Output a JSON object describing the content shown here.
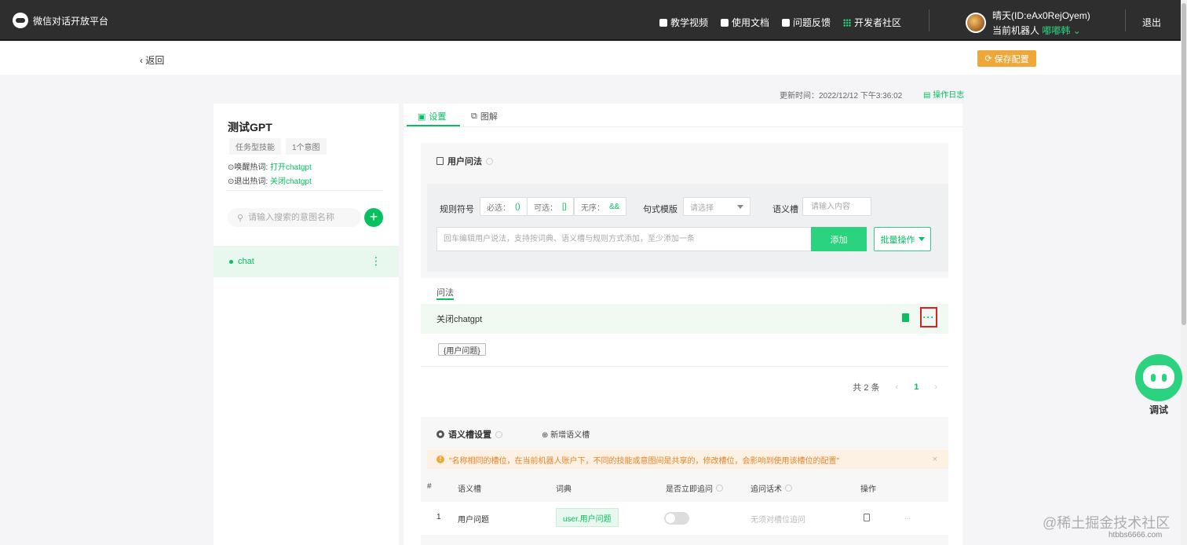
{
  "topbar": {
    "brand": "微信对话开放平台",
    "nav": [
      "教学视频",
      "使用文档",
      "问题反馈",
      "开发者社区"
    ],
    "user_name": "晴天(ID:eAx0RejOyem)",
    "robot_label": "当前机器人",
    "robot_name": "嘟嘟韩",
    "logout": "退出"
  },
  "subheader": {
    "back": "返回",
    "save": "保存配置"
  },
  "meta": {
    "updated": "更新时间：2022/12/12 下午3:36:02",
    "oplog": "操作日志"
  },
  "skill": {
    "title": "测试GPT",
    "tags": [
      "任务型技能",
      "1个意图"
    ],
    "wake_label": "唤醒热词:",
    "wake_value": "打开chatgpt",
    "exit_label": "退出热词:",
    "exit_value": "关闭chatgpt",
    "search_placeholder": "请输入搜索的意图名称",
    "add": "+",
    "intents": [
      "chat"
    ]
  },
  "tabs": [
    "设置",
    "图解"
  ],
  "user_utterance": {
    "title": "用户问法",
    "rule_label": "规则符号",
    "chips": [
      {
        "label": "必选：",
        "sym": "()"
      },
      {
        "label": "可选：",
        "sym": "[]"
      },
      {
        "label": "无序：",
        "sym": "&&"
      }
    ],
    "template_label": "句式模版",
    "template_placeholder": "请选择",
    "slot_label": "语义槽",
    "slot_placeholder": "请输入内容",
    "input_placeholder": "回车编辑用户说法，支持按词典、语义槽与规则方式添加，至少添加一条",
    "add_btn": "添加",
    "batch_btn": "批量操作",
    "list_tab": "问法",
    "row_text": "关闭chatgpt",
    "row_more": "···",
    "slot_chip": "{用户问题}",
    "total": "共 2 条",
    "page": "1",
    "prev": "‹",
    "next": "›"
  },
  "slot_settings": {
    "title": "语义槽设置",
    "add": "新增语义槽",
    "warning": "\"名称相同的槽位，在当前机器人账户下，不同的技能或意图间是共享的，修改槽位，会影响到使用该槽位的配置\"",
    "close": "×",
    "headers": [
      "#",
      "语义槽",
      "词典",
      "是否立即追问",
      "追问话术",
      "操作"
    ],
    "row": {
      "index": "1",
      "slot": "用户问题",
      "dict": "user.用户问题",
      "followup": "无须对槽位追问",
      "more": "..."
    }
  },
  "debug": "调试",
  "watermark": "@稀土掘金技术社区",
  "watermark2": "htbbs6666.com"
}
